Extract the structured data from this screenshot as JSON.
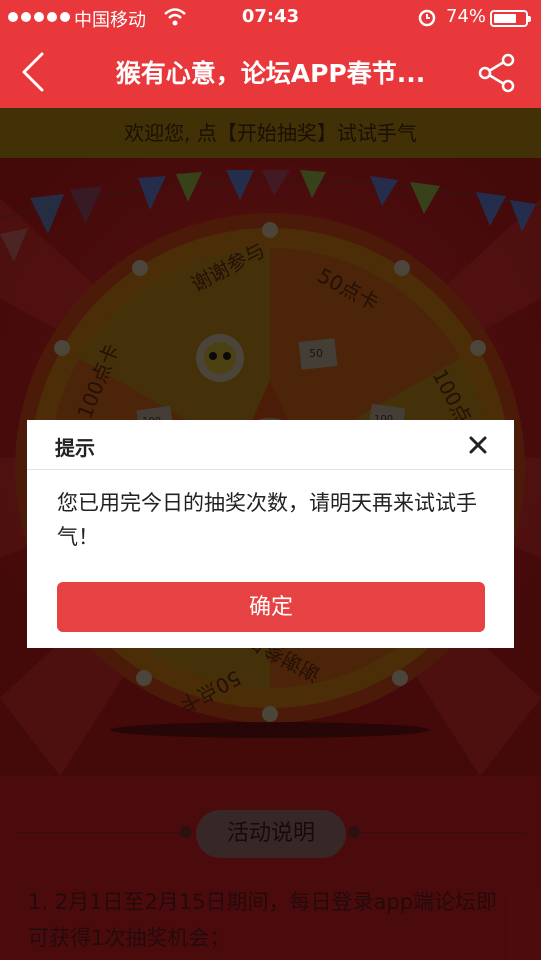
{
  "status_bar": {
    "carrier": "中国移动",
    "time": "07:43",
    "battery_percent": "74%",
    "battery_level": 0.74
  },
  "nav": {
    "back_icon": "chevron-left-icon",
    "title": "猴有心意，论坛APP春节...",
    "share_icon": "share-icon"
  },
  "banner": {
    "welcome": "欢迎您, 点【开始抽奖】试试手气"
  },
  "wheel": {
    "segments": [
      "谢谢参与",
      "50点卡",
      "100点卡",
      "谢谢参与",
      "50点卡",
      "100点卡"
    ],
    "card_labels": [
      "50",
      "100",
      "100"
    ]
  },
  "rules": {
    "title": "活动说明",
    "text": "1. 2月1日至2月15日期间，每日登录app端论坛即可获得1次抽奖机会；"
  },
  "dialog": {
    "title": "提示",
    "message": "您已用完今日的抽奖次数，请明天再来试试手气！",
    "confirm": "确定",
    "close_icon": "close-icon"
  },
  "colors": {
    "accent": "#e8383b",
    "confirm": "#e74243"
  }
}
